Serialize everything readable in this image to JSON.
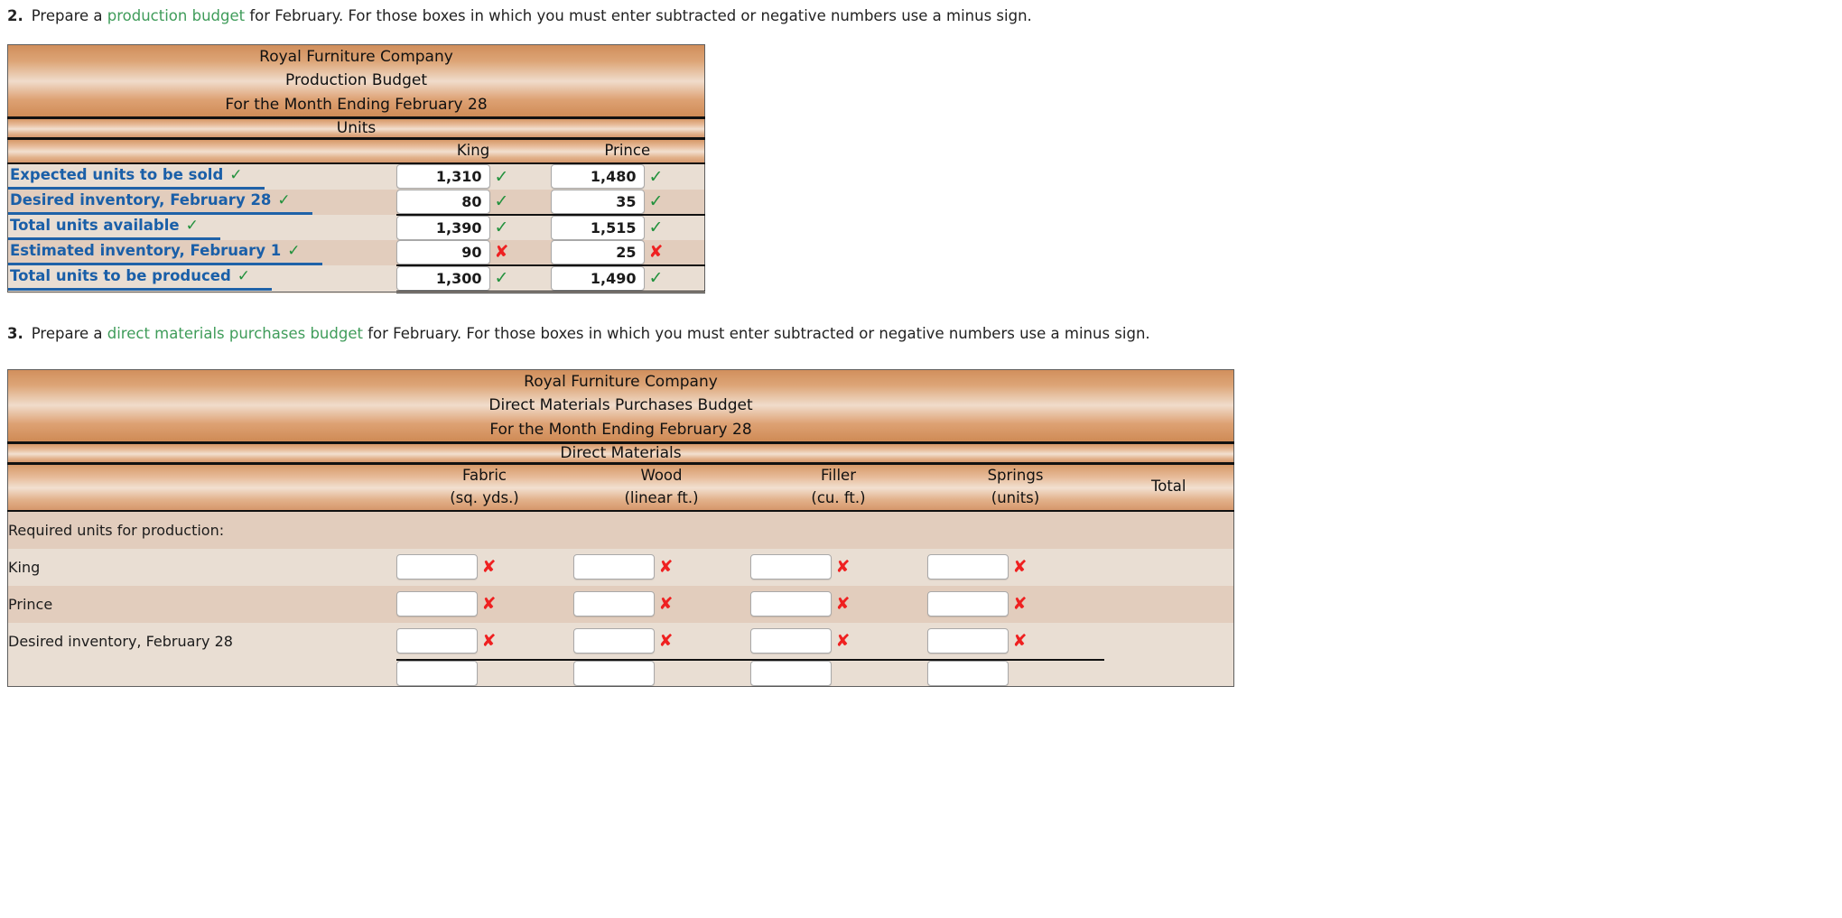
{
  "questions": [
    {
      "number": "2.",
      "prefix": "Prepare a ",
      "link": "production budget",
      "suffix": " for February. For those boxes in which you must enter subtracted or negative numbers use a minus sign."
    },
    {
      "number": "3.",
      "prefix": "Prepare a ",
      "link": "direct materials purchases budget",
      "suffix": " for February. For those boxes in which you must enter subtracted or negative numbers use a minus sign."
    }
  ],
  "colors": {
    "link": "#3f9c5a",
    "label_blue": "#1a5fa8",
    "check_green": "#21913c",
    "cross_red": "#ef2020",
    "band_orange": "#d79b6b",
    "row_light": "#e9ded3",
    "row_dark": "#e2cdbd"
  },
  "icons": {
    "check": "✓",
    "cross": "✘"
  },
  "production_budget": {
    "title_lines": [
      "Royal Furniture Company",
      "Production Budget",
      "For the Month Ending February 28"
    ],
    "group_header": "Units",
    "columns": [
      "King",
      "Prince"
    ],
    "rows": [
      {
        "label": "Expected units to be sold",
        "label_status": "check",
        "values": [
          "1,310",
          "1,480"
        ],
        "statuses": [
          "check",
          "check"
        ],
        "rule_top": false,
        "rule_bottom_double": false
      },
      {
        "label": "Desired inventory, February 28",
        "label_status": "check",
        "values": [
          "80",
          "35"
        ],
        "statuses": [
          "check",
          "check"
        ],
        "rule_top": false,
        "rule_bottom_double": false
      },
      {
        "label": "Total units available",
        "label_status": "check",
        "values": [
          "1,390",
          "1,515"
        ],
        "statuses": [
          "check",
          "check"
        ],
        "rule_top": true,
        "rule_bottom_double": false
      },
      {
        "label": "Estimated inventory, February 1",
        "label_status": "check",
        "values": [
          "90",
          "25"
        ],
        "statuses": [
          "cross",
          "cross"
        ],
        "rule_top": false,
        "rule_bottom_double": false
      },
      {
        "label": "Total units to be produced",
        "label_status": "check",
        "values": [
          "1,300",
          "1,490"
        ],
        "statuses": [
          "check",
          "check"
        ],
        "rule_top": true,
        "rule_bottom_double": true
      }
    ]
  },
  "direct_materials_budget": {
    "title_lines": [
      "Royal Furniture Company",
      "Direct Materials Purchases Budget",
      "For the Month Ending February 28"
    ],
    "group_header": "Direct Materials",
    "columns": [
      {
        "name": "Fabric",
        "unit": "(sq. yds.)"
      },
      {
        "name": "Wood",
        "unit": "(linear ft.)"
      },
      {
        "name": "Filler",
        "unit": "(cu. ft.)"
      },
      {
        "name": "Springs",
        "unit": "(units)"
      },
      {
        "name": "Total",
        "unit": ""
      }
    ],
    "rows": [
      {
        "label": "Required units for production:",
        "type": "section",
        "values": [],
        "statuses": []
      },
      {
        "label": "King",
        "type": "data",
        "values": [
          "",
          "",
          "",
          ""
        ],
        "statuses": [
          "cross",
          "cross",
          "cross",
          "cross"
        ]
      },
      {
        "label": "Prince",
        "type": "data",
        "values": [
          "",
          "",
          "",
          ""
        ],
        "statuses": [
          "cross",
          "cross",
          "cross",
          "cross"
        ]
      },
      {
        "label": "Desired inventory, February 28",
        "type": "data",
        "values": [
          "",
          "",
          "",
          ""
        ],
        "statuses": [
          "cross",
          "cross",
          "cross",
          "cross"
        ],
        "rule_bottom": true
      }
    ]
  }
}
